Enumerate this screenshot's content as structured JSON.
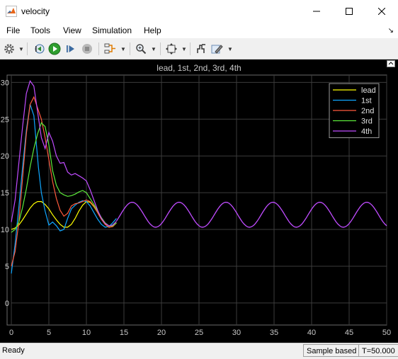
{
  "window": {
    "title": "velocity"
  },
  "menu": [
    "File",
    "Tools",
    "View",
    "Simulation",
    "Help"
  ],
  "toolbar": {
    "icons": [
      "gear-icon",
      "step-back-icon",
      "run-icon",
      "step-forward-icon",
      "stop-icon",
      "signal-select-icon",
      "zoom-icon",
      "fit-view-icon",
      "cursor-icon",
      "highlight-icon"
    ]
  },
  "status": {
    "ready": "Ready",
    "mode": "Sample based",
    "time": "T=50.000"
  },
  "colors": {
    "lead": "#ffff00",
    "1st": "#0fa7ff",
    "2nd": "#ff5a3c",
    "3rd": "#5cea3a",
    "4th": "#c04cff"
  },
  "chart_data": {
    "type": "line",
    "title": "lead, 1st, 2nd, 3rd, 4th",
    "xlabel": "",
    "ylabel": "",
    "xlim": [
      0,
      50
    ],
    "ylim": [
      -3,
      31
    ],
    "xticks": [
      0,
      5,
      10,
      15,
      20,
      25,
      30,
      35,
      40,
      45,
      50
    ],
    "yticks": [
      0,
      5,
      10,
      15,
      20,
      25,
      30
    ],
    "grid": true,
    "legend_position": "top-right",
    "series": [
      {
        "name": "lead",
        "color": "#ffff00",
        "x": [
          0,
          0.5,
          1,
          1.5,
          2,
          2.5,
          3,
          3.5,
          4,
          4.5,
          5,
          5.5,
          6,
          6.5,
          7,
          7.5,
          8,
          8.5,
          9,
          9.5,
          10,
          10.5,
          11,
          11.5,
          12,
          12.5,
          13,
          13.5,
          14
        ],
        "y": [
          10,
          10.2,
          10.6,
          11.3,
          12.1,
          12.9,
          13.5,
          13.8,
          13.8,
          13.4,
          12.8,
          12,
          11.3,
          10.7,
          10.3,
          10.3,
          10.7,
          11.5,
          12.5,
          13.3,
          13.8,
          13.7,
          13.1,
          12.3,
          11.4,
          10.7,
          10.3,
          10.4,
          10.9
        ]
      },
      {
        "name": "1st",
        "color": "#0fa7ff",
        "x": [
          0,
          0.5,
          1,
          1.5,
          2,
          2.5,
          3,
          3.3,
          3.6,
          4,
          4.5,
          5,
          5.5,
          6,
          6.5,
          7,
          7.5,
          8,
          8.5,
          9,
          9.5,
          10,
          10.5,
          11,
          11.5,
          12,
          12.5,
          13,
          13.5,
          14
        ],
        "y": [
          4,
          8,
          13,
          18.5,
          23.5,
          27,
          25.5,
          22,
          18.5,
          15,
          12.5,
          10.6,
          11,
          10.5,
          9.8,
          10,
          11.5,
          12.8,
          13.3,
          13.7,
          13.9,
          13.8,
          13.2,
          12.3,
          11.4,
          10.7,
          10.3,
          10.4,
          10.9,
          11.5
        ]
      },
      {
        "name": "2nd",
        "color": "#ff5a3c",
        "x": [
          0,
          0.5,
          1,
          1.5,
          2,
          2.5,
          3,
          3.5,
          4,
          4.5,
          5,
          5.5,
          6,
          6.5,
          7,
          7.5,
          8,
          8.5,
          9,
          9.5,
          10,
          10.5,
          11,
          11.5,
          12,
          12.5,
          13,
          13.5,
          14
        ],
        "y": [
          5,
          7,
          11,
          17,
          23,
          27,
          28,
          26.5,
          25,
          22.5,
          19.5,
          16.5,
          14.2,
          12.6,
          11.8,
          12.2,
          13.2,
          13.5,
          13.6,
          13.8,
          14,
          13.8,
          13.2,
          12.3,
          11.4,
          10.7,
          10.3,
          10.4,
          10.9
        ]
      },
      {
        "name": "3rd",
        "color": "#5cea3a",
        "x": [
          0,
          0.5,
          1,
          1.5,
          2,
          2.5,
          3,
          3.5,
          4,
          4.5,
          5,
          5.5,
          6,
          6.5,
          7,
          7.5,
          8,
          8.5,
          9,
          9.5,
          10,
          10.5,
          11,
          11.5,
          12,
          12.5,
          13,
          13.5,
          14
        ],
        "y": [
          9.6,
          10,
          11,
          13,
          15.5,
          18.5,
          21,
          23,
          24.5,
          24,
          21.5,
          18,
          16,
          15,
          14.7,
          14.5,
          14.6,
          14.8,
          15.1,
          15.3,
          15,
          14.2,
          13.4,
          12.5,
          11.6,
          10.9,
          10.5,
          10.5,
          10.9
        ]
      },
      {
        "name": "4th",
        "color": "#c04cff",
        "x": [
          0,
          0.5,
          1,
          1.5,
          2,
          2.5,
          3,
          3.5,
          4,
          4.5,
          5,
          5.5,
          6,
          6.5,
          7,
          7.5,
          8,
          8.5,
          9,
          9.5,
          10,
          10.5,
          11,
          11.5,
          12,
          12.5,
          13,
          13.5,
          14
        ],
        "y": [
          11,
          14,
          19,
          24,
          28.5,
          30.2,
          29.5,
          26,
          22.5,
          21,
          23.2,
          22,
          20,
          19,
          19.1,
          17.8,
          17.4,
          17.6,
          17.3,
          17,
          16.6,
          15.4,
          14,
          12.6,
          11.5,
          10.8,
          10.5,
          10.6,
          11.1
        ]
      }
    ],
    "steady": {
      "from": 14,
      "to": 50,
      "mean": 12,
      "amplitude": 1.7,
      "period": 6.25,
      "peak_at": 16.1
    }
  }
}
